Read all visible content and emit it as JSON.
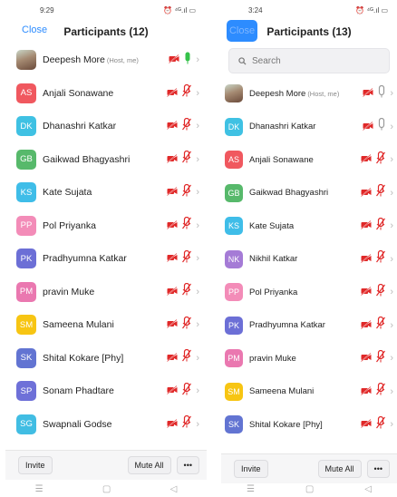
{
  "left": {
    "status_time": "9:29",
    "status_right": "⏰ ⁴ᴳ.ıl ▭",
    "close_label": "Close",
    "title": "Participants (12)",
    "participants": [
      {
        "initials": "",
        "name": "Deepesh More",
        "tag": "(Host, me)",
        "photo": true,
        "color": "#9a7a66",
        "mic": "on"
      },
      {
        "initials": "AS",
        "name": "Anjali Sonawane",
        "tag": "",
        "photo": false,
        "color": "#f0585f",
        "mic": "muted"
      },
      {
        "initials": "DK",
        "name": "Dhanashri Katkar",
        "tag": "",
        "photo": false,
        "color": "#3fc1e3",
        "mic": "muted"
      },
      {
        "initials": "GB",
        "name": "Gaikwad Bhagyashri",
        "tag": "",
        "photo": false,
        "color": "#57b96b",
        "mic": "muted"
      },
      {
        "initials": "KS",
        "name": "Kate Sujata",
        "tag": "",
        "photo": false,
        "color": "#3fbde8",
        "mic": "muted"
      },
      {
        "initials": "PP",
        "name": "Pol Priyanka",
        "tag": "",
        "photo": false,
        "color": "#f38cb8",
        "mic": "muted"
      },
      {
        "initials": "PK",
        "name": "Pradhyumna Katkar",
        "tag": "",
        "photo": false,
        "color": "#6c6fd6",
        "mic": "muted"
      },
      {
        "initials": "PM",
        "name": "pravin Muke",
        "tag": "",
        "photo": false,
        "color": "#ea78b0",
        "mic": "muted"
      },
      {
        "initials": "SM",
        "name": "Sameena Mulani",
        "tag": "",
        "photo": false,
        "color": "#f7c513",
        "mic": "muted"
      },
      {
        "initials": "SK",
        "name": "Shital Kokare [Phy]",
        "tag": "",
        "photo": false,
        "color": "#6274d2",
        "mic": "muted"
      },
      {
        "initials": "SP",
        "name": "Sonam Phadtare",
        "tag": "",
        "photo": false,
        "color": "#6e70d8",
        "mic": "muted"
      },
      {
        "initials": "SG",
        "name": "Swapnali Godse",
        "tag": "",
        "photo": false,
        "color": "#41bde3",
        "mic": "muted"
      }
    ],
    "invite_label": "Invite",
    "mute_all_label": "Mute All",
    "more_label": "•••"
  },
  "right": {
    "status_time": "3:24",
    "status_right": "⏰ ⁴ᴳ.ıl ▭",
    "close_label": "Close",
    "title": "Participants (13)",
    "search_placeholder": "Search",
    "participants": [
      {
        "initials": "",
        "name": "Deepesh More",
        "tag": "(Host, me)",
        "photo": true,
        "color": "#9a7a66",
        "mic": "grey"
      },
      {
        "initials": "DK",
        "name": "Dhanashri Katkar",
        "tag": "",
        "photo": false,
        "color": "#3fc1e3",
        "mic": "grey"
      },
      {
        "initials": "AS",
        "name": "Anjali Sonawane",
        "tag": "",
        "photo": false,
        "color": "#f0585f",
        "mic": "muted"
      },
      {
        "initials": "GB",
        "name": "Gaikwad Bhagyashri",
        "tag": "",
        "photo": false,
        "color": "#57b96b",
        "mic": "muted"
      },
      {
        "initials": "KS",
        "name": "Kate Sujata",
        "tag": "",
        "photo": false,
        "color": "#3fbde8",
        "mic": "muted"
      },
      {
        "initials": "NK",
        "name": "Nikhil Katkar",
        "tag": "",
        "photo": false,
        "color": "#a57bd6",
        "mic": "muted"
      },
      {
        "initials": "PP",
        "name": "Pol Priyanka",
        "tag": "",
        "photo": false,
        "color": "#f38cb8",
        "mic": "muted"
      },
      {
        "initials": "PK",
        "name": "Pradhyumna Katkar",
        "tag": "",
        "photo": false,
        "color": "#6c6fd6",
        "mic": "muted"
      },
      {
        "initials": "PM",
        "name": "pravin Muke",
        "tag": "",
        "photo": false,
        "color": "#ea78b0",
        "mic": "muted"
      },
      {
        "initials": "SM",
        "name": "Sameena Mulani",
        "tag": "",
        "photo": false,
        "color": "#f7c513",
        "mic": "muted"
      },
      {
        "initials": "SK",
        "name": "Shital Kokare [Phy]",
        "tag": "",
        "photo": false,
        "color": "#6274d2",
        "mic": "muted"
      }
    ],
    "invite_label": "Invite",
    "mute_all_label": "Mute All",
    "more_label": "•••"
  },
  "colors": {
    "accent": "#2d8cff",
    "muted_red": "#e02828",
    "mic_green": "#35c24a"
  },
  "nav_icons": [
    "menu-icon",
    "home-icon",
    "back-icon"
  ]
}
